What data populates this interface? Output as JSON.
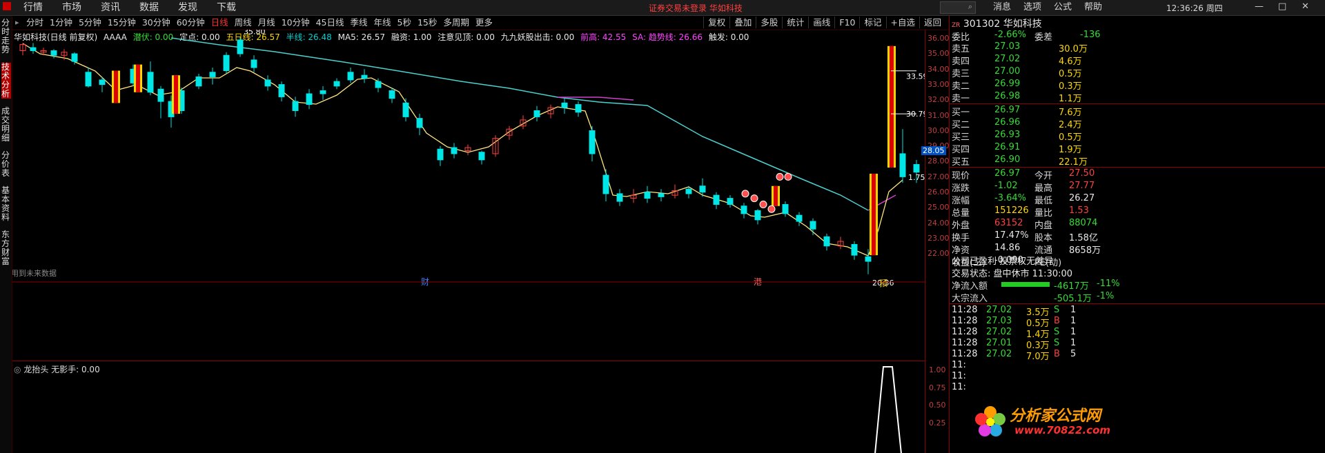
{
  "top_menu": [
    "行情",
    "市场",
    "资讯",
    "数据",
    "发现",
    "下载"
  ],
  "notice": "证券交易未登录 华如科技",
  "top_right": [
    "消息",
    "选项",
    "公式",
    "帮助"
  ],
  "clock": "12:36:26 周四",
  "left_nav": [
    "分时走势",
    "技术分析",
    "成交明细",
    "分价表",
    "基本资料",
    "东方财富"
  ],
  "periods": [
    "分时",
    "1分钟",
    "5分钟",
    "15分钟",
    "30分钟",
    "60分钟",
    "日线",
    "周线",
    "月线",
    "10分钟",
    "45日线",
    "季线",
    "年线",
    "5秒",
    "15秒",
    "多周期",
    "更多"
  ],
  "selected_period": "日线",
  "tools": [
    "复权",
    "叠加",
    "多股",
    "统计",
    "画线",
    "F10",
    "标记",
    "+自选",
    "返回"
  ],
  "info": {
    "name": "华如科技(日线 前复权)",
    "ind": "AAAA",
    "qianfu": "潜伏: 0.00",
    "dingdian": "定点: 0.00",
    "ma5": "五日线: 26.57",
    "half": "半线: 26.48",
    "ma5b": "MA5: 26.57",
    "rongzi": "融资: 1.00",
    "zhuyi": "注意见顶: 0.00",
    "jiujiu": "九九妖股出击: 0.00",
    "qiangao": "前高: 42.55",
    "sa": "SA: 趋势线: 26.66",
    "chufa": "触发: 0.00"
  },
  "chart_labels": {
    "high1": "35.80",
    "h2": "33.590",
    "h3": "30.790",
    "cur": "28.05",
    "low": "20.36",
    "ma": "1.75",
    "future": "用到未来数据",
    "cai": "财",
    "gang": "港",
    "yu": "预"
  },
  "price_axis": [
    "36.00",
    "35.00",
    "34.00",
    "33.00",
    "32.00",
    "31.00",
    "30.00",
    "29.00",
    "28.00",
    "27.00",
    "26.00",
    "25.00",
    "24.00",
    "23.00",
    "22.00"
  ],
  "sub": {
    "title": "龙抬头 无影手: 0.00",
    "axis": [
      "1.00",
      "0.75",
      "0.50",
      "0.25"
    ]
  },
  "quote": {
    "code": "301302",
    "name": "华如科技",
    "weibi_l": "委比",
    "weibi": "-2.66%",
    "weicha_l": "委差",
    "weicha": "-136",
    "sell": [
      [
        "卖五",
        "27.03",
        "30.0万"
      ],
      [
        "卖四",
        "27.02",
        "4.6万"
      ],
      [
        "卖三",
        "27.00",
        "0.5万"
      ],
      [
        "卖二",
        "26.99",
        "0.3万"
      ],
      [
        "卖一",
        "26.98",
        "1.1万"
      ]
    ],
    "buy": [
      [
        "买一",
        "26.97",
        "7.6万"
      ],
      [
        "买二",
        "26.96",
        "2.4万"
      ],
      [
        "买三",
        "26.93",
        "0.5万"
      ],
      [
        "买四",
        "26.91",
        "1.9万"
      ],
      [
        "买五",
        "26.90",
        "22.1万"
      ]
    ],
    "stats": [
      [
        "现价",
        "26.97",
        "今开",
        "27.50"
      ],
      [
        "涨跌",
        "-1.02",
        "最高",
        "27.77"
      ],
      [
        "涨幅",
        "-3.64%",
        "最低",
        "26.27"
      ],
      [
        "总量",
        "151226",
        "量比",
        "1.53"
      ],
      [
        "外盘",
        "63152",
        "内盘",
        "88074"
      ],
      [
        "换手",
        "17.47%",
        "股本",
        "1.58亿"
      ],
      [
        "净资",
        "14.86",
        "流通",
        "8658万"
      ],
      [
        "收益(三)",
        "-0.090",
        "PE(动)",
        ""
      ]
    ],
    "company": "公司已盈利 投票权无差异",
    "trade_state": "交易状态: 盘中休市 11:30:00",
    "flow1": [
      "净流入额",
      "-4617万",
      "-11%"
    ],
    "flow2": [
      "大宗流入",
      "-505.1万",
      "-1%"
    ],
    "ticks": [
      [
        "11:28",
        "27.02",
        "3.5万",
        "S",
        "1"
      ],
      [
        "11:28",
        "27.03",
        "0.5万",
        "B",
        "1"
      ],
      [
        "11:28",
        "27.02",
        "1.4万",
        "S",
        "1"
      ],
      [
        "11:28",
        "27.01",
        "0.3万",
        "S",
        "1"
      ],
      [
        "11:28",
        "27.02",
        "7.0万",
        "B",
        "5"
      ]
    ],
    "ticks_partial": [
      "11:",
      "11:",
      "11:"
    ]
  },
  "watermark": {
    "text": "分析家公式网",
    "url": "www.70822.com"
  }
}
